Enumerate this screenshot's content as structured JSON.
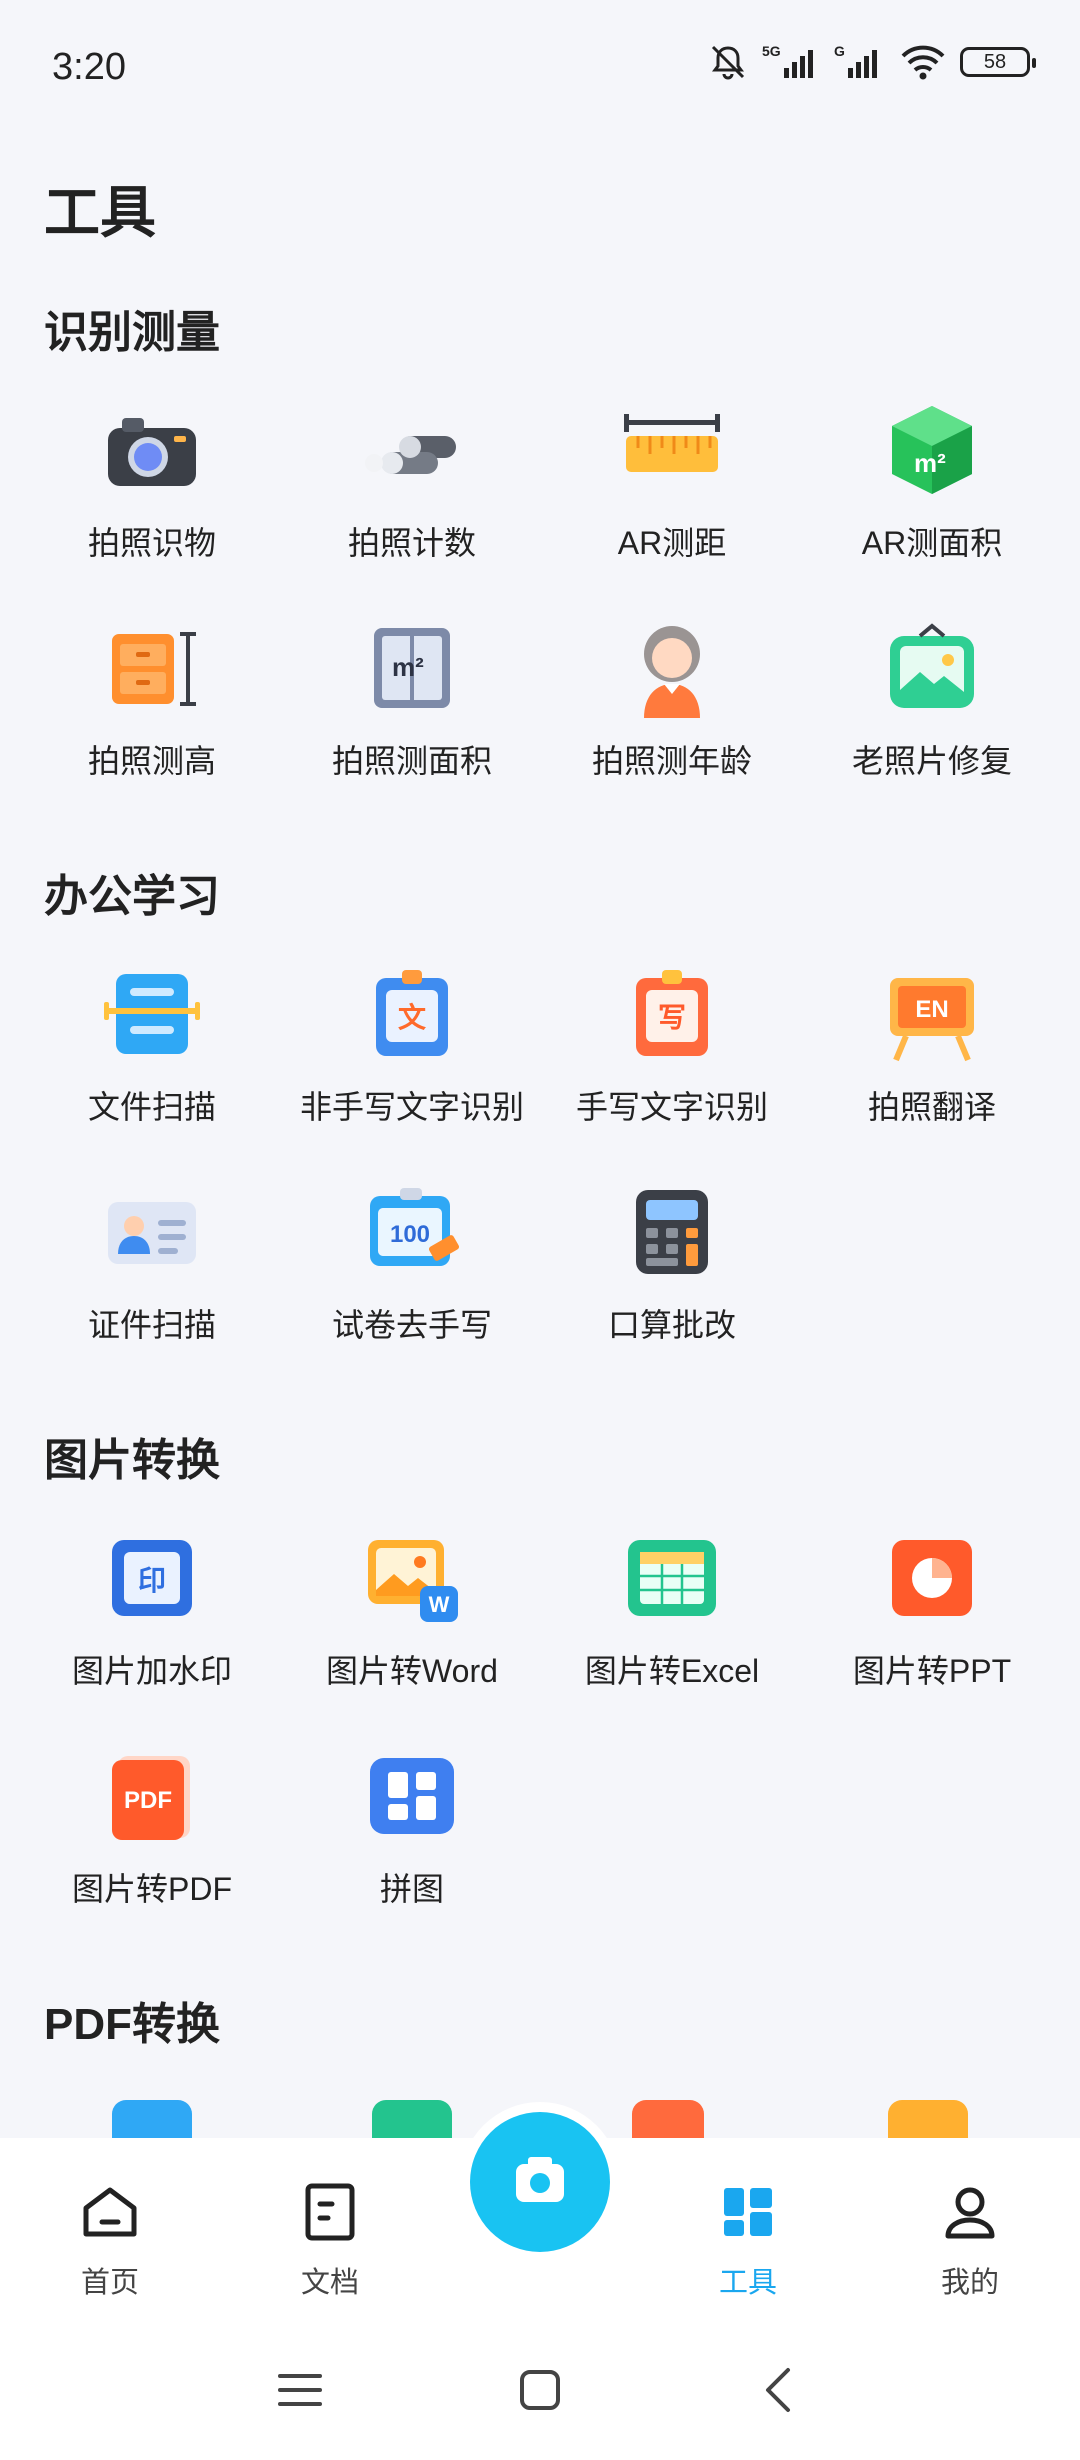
{
  "status": {
    "time": "3:20",
    "battery": "58"
  },
  "page_title": "工具",
  "sections": [
    {
      "title": "识别测量",
      "items": [
        {
          "label": "拍照识物",
          "icon": "camera-icon"
        },
        {
          "label": "拍照计数",
          "icon": "pipes-count-icon"
        },
        {
          "label": "AR测距",
          "icon": "ruler-icon"
        },
        {
          "label": "AR测面积",
          "icon": "area-cube-icon"
        },
        {
          "label": "拍照测高",
          "icon": "height-cabinet-icon"
        },
        {
          "label": "拍照测面积",
          "icon": "window-area-icon"
        },
        {
          "label": "拍照测年龄",
          "icon": "person-age-icon"
        },
        {
          "label": "老照片修复",
          "icon": "photo-restore-icon"
        }
      ]
    },
    {
      "title": "办公学习",
      "items": [
        {
          "label": "文件扫描",
          "icon": "document-scan-icon"
        },
        {
          "label": "非手写文字识别",
          "icon": "print-text-ocr-icon",
          "glyph": "文"
        },
        {
          "label": "手写文字识别",
          "icon": "handwriting-ocr-icon",
          "glyph": "写"
        },
        {
          "label": "拍照翻译",
          "icon": "translate-board-icon",
          "glyph": "EN"
        },
        {
          "label": "证件扫描",
          "icon": "id-card-icon"
        },
        {
          "label": "试卷去手写",
          "icon": "exam-erase-icon",
          "glyph": "100"
        },
        {
          "label": "口算批改",
          "icon": "calculator-icon"
        }
      ]
    },
    {
      "title": "图片转换",
      "items": [
        {
          "label": "图片加水印",
          "icon": "watermark-icon",
          "glyph": "印"
        },
        {
          "label": "图片转Word",
          "icon": "image-to-word-icon",
          "glyph": "W"
        },
        {
          "label": "图片转Excel",
          "icon": "image-to-excel-icon"
        },
        {
          "label": "图片转PPT",
          "icon": "image-to-ppt-icon"
        },
        {
          "label": "图片转PDF",
          "icon": "image-to-pdf-icon",
          "glyph": "PDF"
        },
        {
          "label": "拼图",
          "icon": "collage-icon"
        }
      ]
    },
    {
      "title": "PDF转换",
      "items": []
    }
  ],
  "nav": [
    {
      "label": "首页",
      "icon": "home-icon"
    },
    {
      "label": "文档",
      "icon": "document-icon"
    },
    {
      "label": "工具",
      "icon": "tools-grid-icon",
      "active": true
    },
    {
      "label": "我的",
      "icon": "user-icon"
    }
  ],
  "colors": {
    "accent": "#1aa7ef",
    "camera_fab": "#19c3f2",
    "background": "#f5f6fa"
  }
}
